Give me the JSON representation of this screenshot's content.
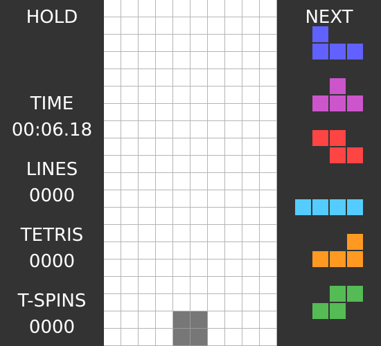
{
  "hold": {
    "label": "HOLD"
  },
  "time": {
    "label": "TIME",
    "value": "00:06.18"
  },
  "lines": {
    "label": "LINES",
    "value": "0000"
  },
  "tetris": {
    "label": "TETRIS",
    "value": "0000"
  },
  "tspins": {
    "label": "T-SPINS",
    "value": "0000"
  },
  "next": {
    "label": "NEXT",
    "queue": [
      {
        "piece": "J",
        "color": "#6161ff"
      },
      {
        "piece": "T",
        "color": "#cc55cc"
      },
      {
        "piece": "Z",
        "color": "#ff4444"
      },
      {
        "piece": "I",
        "color": "#55ccff"
      },
      {
        "piece": "L",
        "color": "#ff9922"
      },
      {
        "piece": "S",
        "color": "#55bb55"
      }
    ]
  },
  "board": {
    "columns": 10,
    "rows": 20,
    "filled_cells": [
      [
        18,
        4
      ],
      [
        18,
        5
      ],
      [
        19,
        4
      ],
      [
        19,
        5
      ]
    ],
    "filled_color": "#777777"
  }
}
